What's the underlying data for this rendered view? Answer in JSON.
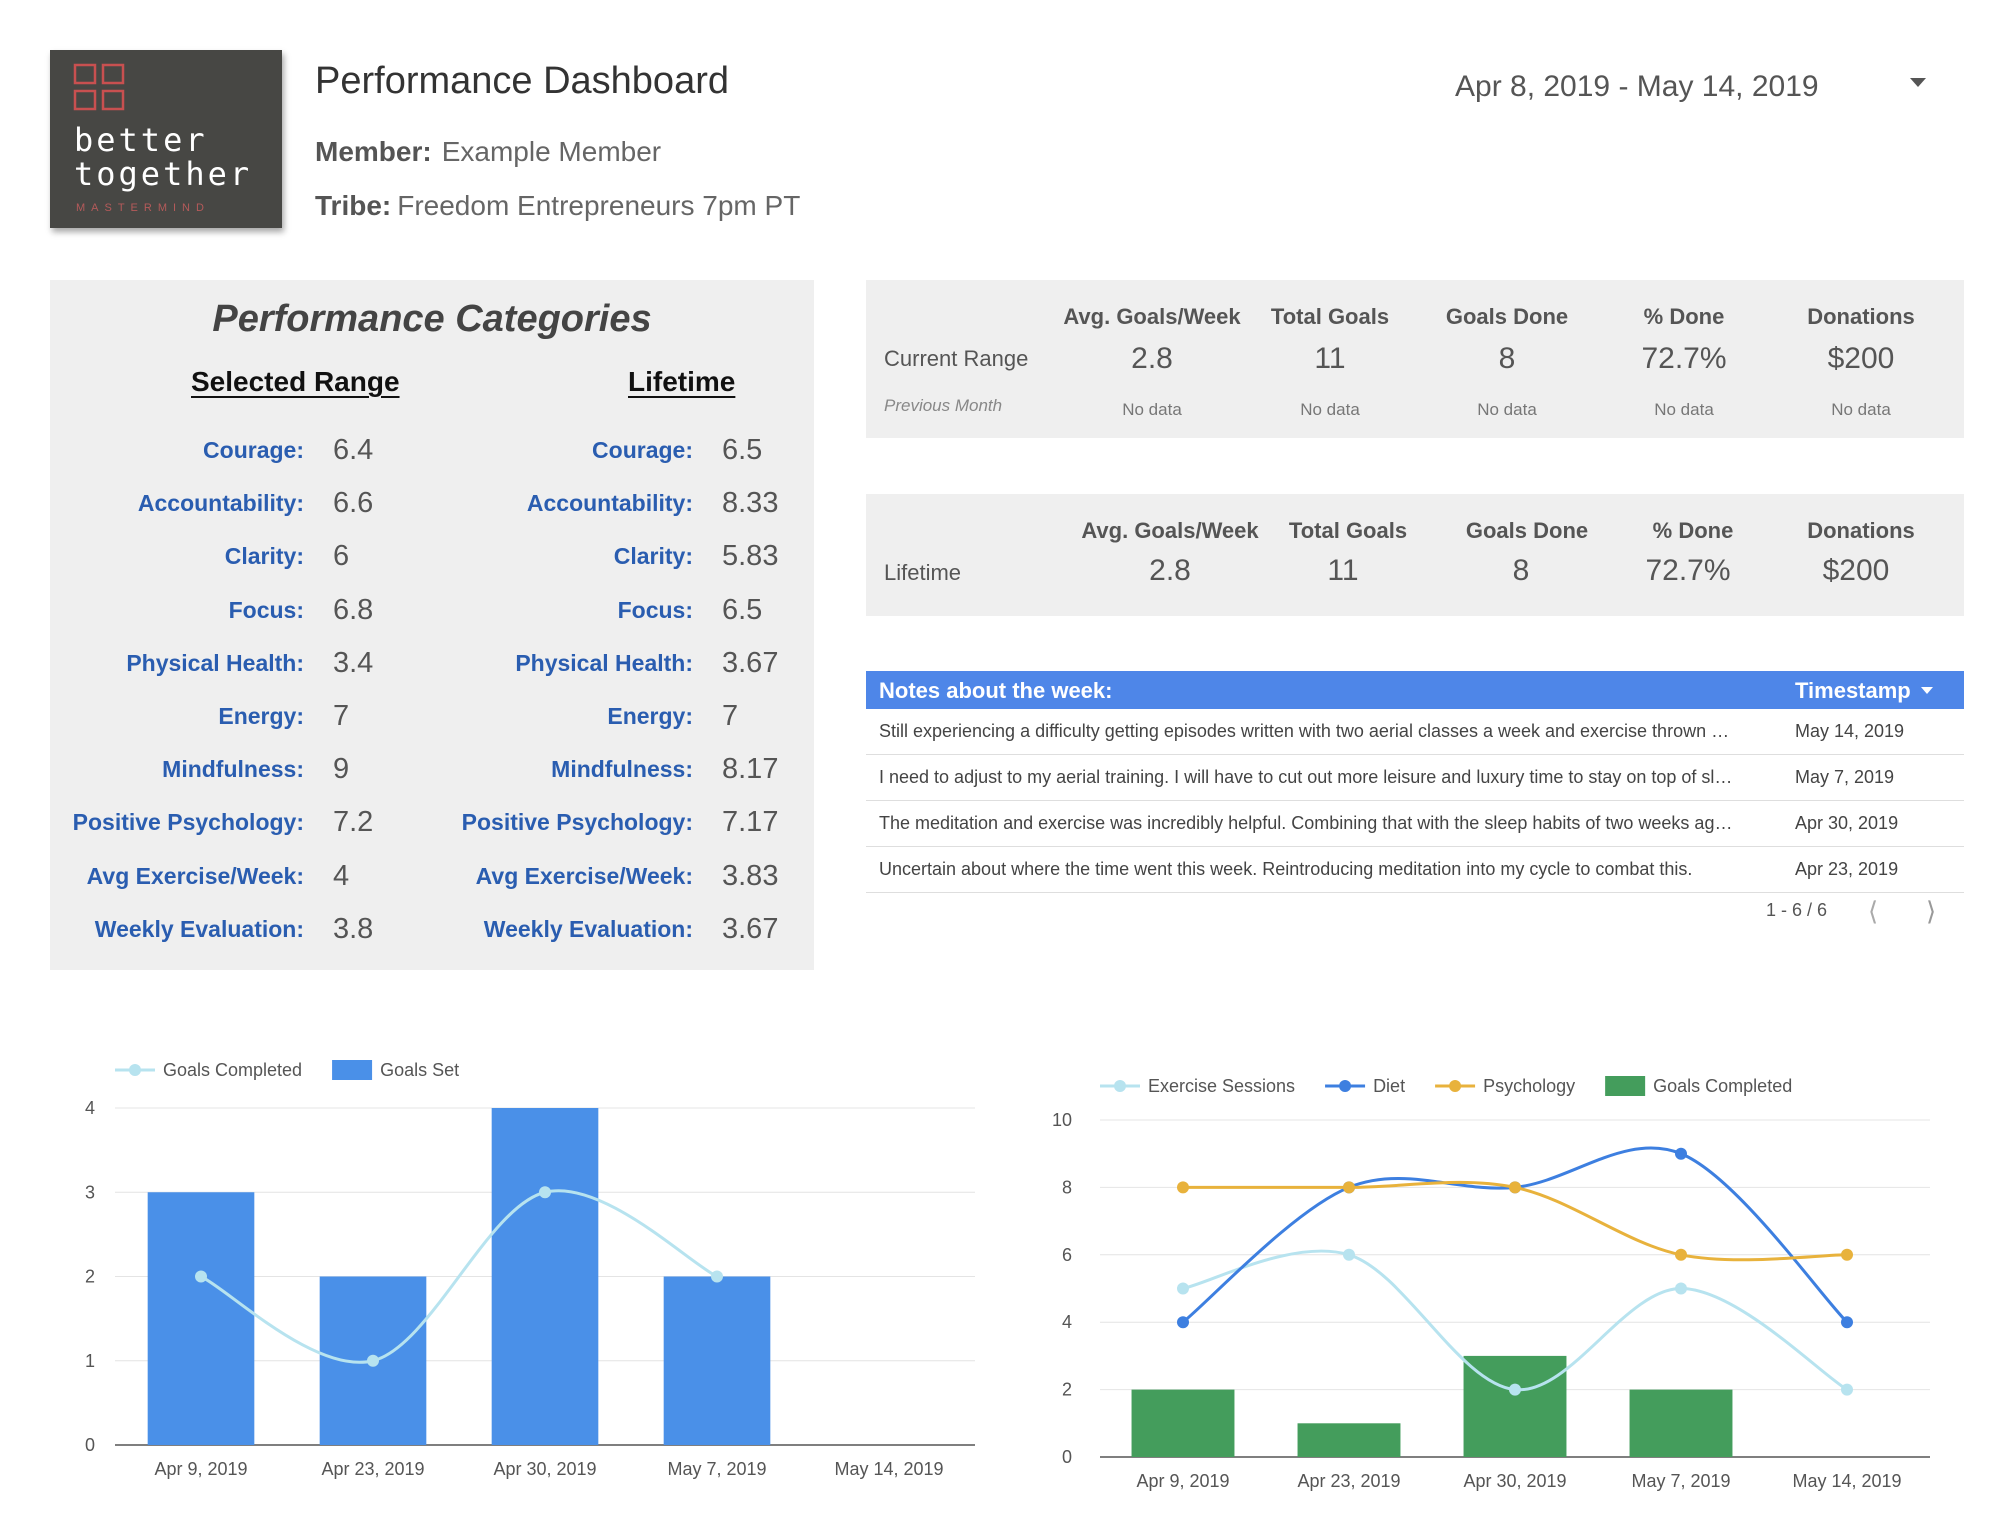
{
  "logo": {
    "line1": "better",
    "line2": "together",
    "line3": "MASTERMIND"
  },
  "header": {
    "title": "Performance Dashboard",
    "member_label": "Member:",
    "member_value": "Example Member",
    "tribe_label": "Tribe:",
    "tribe_value": "Freedom Entrepreneurs 7pm PT",
    "date_range": "Apr 8, 2019 - May 14, 2019"
  },
  "categories": {
    "title": "Performance Categories",
    "selected_heading": "Selected Range",
    "lifetime_heading": "Lifetime",
    "rows": [
      {
        "label": "Courage:",
        "selected": "6.4",
        "lifetime": "6.5"
      },
      {
        "label": "Accountability:",
        "selected": "6.6",
        "lifetime": "8.33"
      },
      {
        "label": "Clarity:",
        "selected": "6",
        "lifetime": "5.83"
      },
      {
        "label": "Focus:",
        "selected": "6.8",
        "lifetime": "6.5"
      },
      {
        "label": "Physical Health:",
        "selected": "3.4",
        "lifetime": "3.67"
      },
      {
        "label": "Energy:",
        "selected": "7",
        "lifetime": "7"
      },
      {
        "label": "Mindfulness:",
        "selected": "9",
        "lifetime": "8.17"
      },
      {
        "label": "Positive Psychology:",
        "selected": "7.2",
        "lifetime": "7.17"
      },
      {
        "label": "Avg Exercise/Week:",
        "selected": "4",
        "lifetime": "3.83"
      },
      {
        "label": "Weekly Evaluation:",
        "selected": "3.8",
        "lifetime": "3.67"
      }
    ]
  },
  "kpi_current": {
    "headers": [
      "Avg. Goals/Week",
      "Total Goals",
      "Goals Done",
      "% Done",
      "Donations"
    ],
    "row_label": "Current Range",
    "values": [
      "2.8",
      "11",
      "8",
      "72.7%",
      "$200"
    ],
    "sub_label": "Previous Month",
    "sub_values": [
      "No data",
      "No data",
      "No data",
      "No data",
      "No data"
    ]
  },
  "kpi_lifetime": {
    "headers": [
      "Avg. Goals/Week",
      "Total Goals",
      "Goals Done",
      "% Done",
      "Donations"
    ],
    "row_label": "Lifetime",
    "values": [
      "2.8",
      "11",
      "8",
      "72.7%",
      "$200"
    ]
  },
  "notes": {
    "header": "Notes about the week:",
    "timestamp_header": "Timestamp",
    "rows": [
      {
        "text": "Still experiencing a difficulty getting episodes written with two aerial classes a week and exercise thrown …",
        "timestamp": "May 14, 2019"
      },
      {
        "text": "I need to adjust to my aerial training. I will have to cut out more leisure and luxury time to stay on top of sl…",
        "timestamp": "May 7, 2019"
      },
      {
        "text": "The meditation and exercise was incredibly helpful. Combining that with the sleep habits of two weeks ag…",
        "timestamp": "Apr 30, 2019"
      },
      {
        "text": "Uncertain about where the time went this week. Reintroducing meditation into my cycle to combat this.",
        "timestamp": "Apr 23, 2019"
      }
    ],
    "pagination": "1 - 6 / 6"
  },
  "colors": {
    "accent_blue": "#4e86e8",
    "label_blue": "#2a5db0",
    "bar_blue": "#4a90e8",
    "line_light": "#b7e3ef",
    "line_blue": "#3d7fe0",
    "line_orange": "#e8b23c",
    "bar_green": "#449d5c"
  },
  "chart_data": [
    {
      "type": "bar",
      "categories": [
        "Apr 9, 2019",
        "Apr 23, 2019",
        "Apr 30, 2019",
        "May 7, 2019",
        "May 14, 2019"
      ],
      "series": [
        {
          "name": "Goals Set",
          "kind": "bar",
          "values": [
            3,
            2,
            4,
            2,
            null
          ]
        },
        {
          "name": "Goals Completed",
          "kind": "line",
          "values": [
            2,
            1,
            3,
            2,
            null
          ]
        }
      ],
      "ylim": [
        0,
        4
      ],
      "yticks": [
        0,
        1,
        2,
        3,
        4
      ],
      "legend": "top-left",
      "grid": true
    },
    {
      "type": "line",
      "categories": [
        "Apr 9, 2019",
        "Apr 23, 2019",
        "Apr 30, 2019",
        "May 7, 2019",
        "May 14, 2019"
      ],
      "series": [
        {
          "name": "Exercise Sessions",
          "kind": "line",
          "values": [
            5,
            6,
            2,
            5,
            2
          ]
        },
        {
          "name": "Diet",
          "kind": "line",
          "values": [
            4,
            8,
            8,
            9,
            4
          ]
        },
        {
          "name": "Psychology",
          "kind": "line",
          "values": [
            8,
            8,
            8,
            6,
            6
          ]
        },
        {
          "name": "Goals Completed",
          "kind": "bar",
          "values": [
            2,
            1,
            3,
            2,
            0
          ]
        }
      ],
      "ylim": [
        0,
        10
      ],
      "yticks": [
        0,
        2,
        4,
        6,
        8,
        10
      ],
      "legend": "top-left",
      "grid": true
    }
  ]
}
